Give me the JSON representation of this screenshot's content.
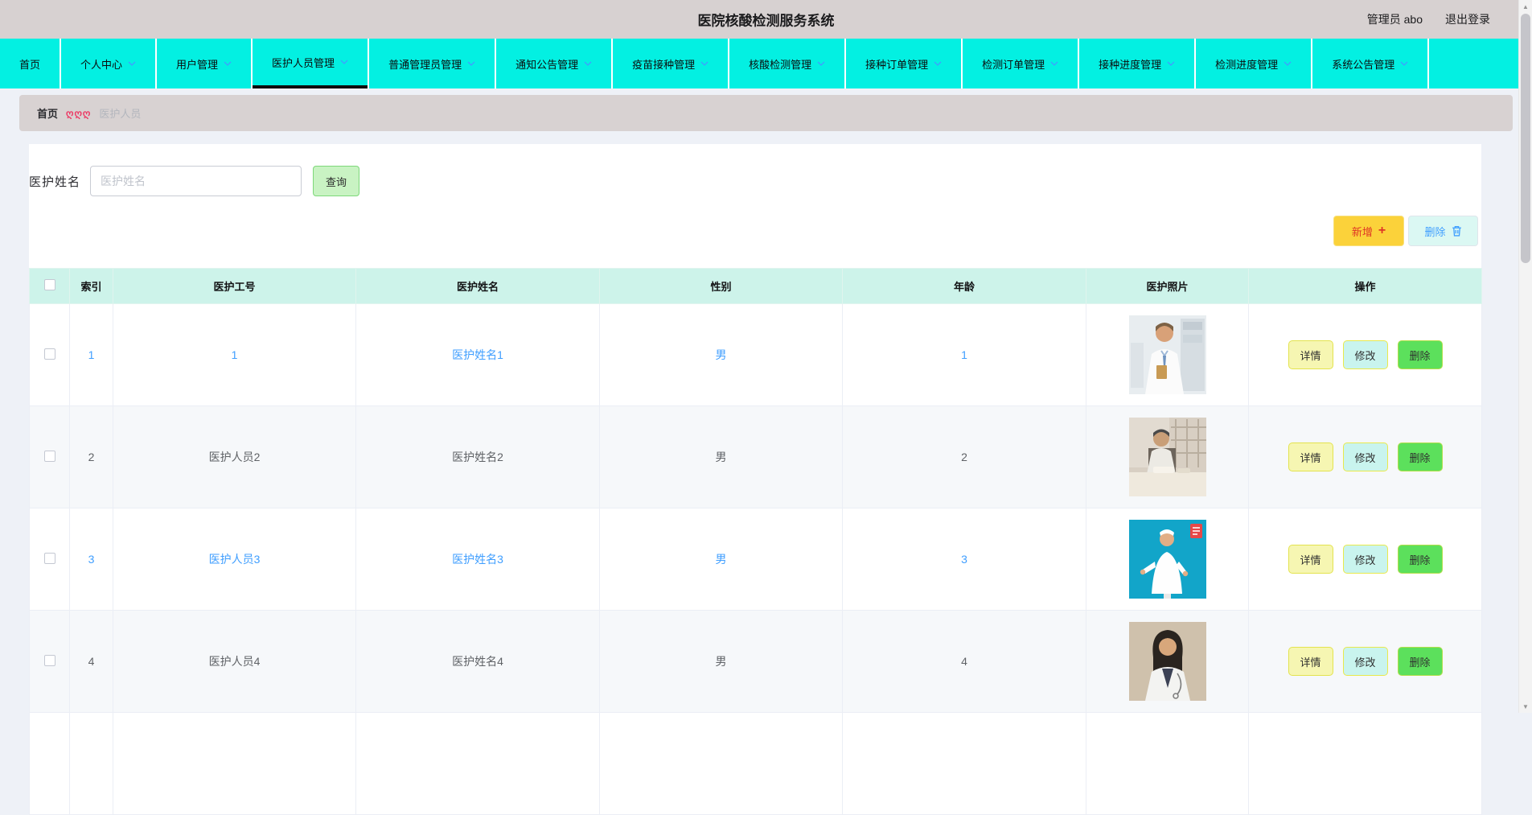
{
  "header": {
    "title": "医院核酸检测服务系统",
    "user_label": "管理员 abo",
    "logout_label": "退出登录"
  },
  "nav": {
    "active_tab": "医护人员管理",
    "tabs": [
      {
        "label": "首页",
        "has_dropdown": false
      },
      {
        "label": "个人中心",
        "has_dropdown": true
      },
      {
        "label": "用户管理",
        "has_dropdown": true
      },
      {
        "label": "医护人员管理",
        "has_dropdown": true
      },
      {
        "label": "普通管理员管理",
        "has_dropdown": true
      },
      {
        "label": "通知公告管理",
        "has_dropdown": true
      },
      {
        "label": "疫苗接种管理",
        "has_dropdown": true
      },
      {
        "label": "核酸检测管理",
        "has_dropdown": true
      },
      {
        "label": "接种订单管理",
        "has_dropdown": true
      },
      {
        "label": "检测订单管理",
        "has_dropdown": true
      },
      {
        "label": "接种进度管理",
        "has_dropdown": true
      },
      {
        "label": "检测进度管理",
        "has_dropdown": true
      },
      {
        "label": "系统公告管理",
        "has_dropdown": true
      }
    ]
  },
  "breadcrumb": {
    "home": "首页",
    "separator": "ღღღ",
    "current": "医护人员"
  },
  "search": {
    "label": "医护姓名",
    "placeholder": "医护姓名",
    "value": "",
    "query_button": "查询"
  },
  "toolbar": {
    "add_label": "新增",
    "add_icon": "+",
    "delete_label": "删除",
    "delete_icon": "trash-icon"
  },
  "table": {
    "columns": [
      "索引",
      "医护工号",
      "医护姓名",
      "性别",
      "年龄",
      "医护照片",
      "操作"
    ],
    "actions": [
      "详情",
      "修改",
      "删除"
    ],
    "rows": [
      {
        "index": "1",
        "staff_no": "1",
        "name": "医护姓名1",
        "gender": "男",
        "age": "1",
        "photo": "male-doctor-standing",
        "text_style": "link-blue"
      },
      {
        "index": "2",
        "staff_no": "医护人员2",
        "name": "医护姓名2",
        "gender": "男",
        "age": "2",
        "photo": "doctor-at-desk",
        "text_style": "normal"
      },
      {
        "index": "3",
        "staff_no": "医护人员3",
        "name": "医护姓名3",
        "gender": "男",
        "age": "3",
        "photo": "nurse-teal-background",
        "text_style": "link-blue"
      },
      {
        "index": "4",
        "staff_no": "医护人员4",
        "name": "医护姓名4",
        "gender": "男",
        "age": "4",
        "photo": "female-doctor",
        "text_style": "normal"
      }
    ]
  },
  "colors": {
    "header_bar": "#d7d1d1",
    "nav_cyan": "#03f0e2",
    "table_header_mint": "#cdf3ea",
    "link_blue": "#3f9eff",
    "breadcrumb_separator_pink": "#ec3c66",
    "add_button_yellow": "#fbd23a",
    "add_button_text_red": "#df3526",
    "delete_button_cyan": "#dbf8f3",
    "query_button_green": "#c9f3c3",
    "action_detail_yellow": "#f6f6b2",
    "action_edit_cyan": "#c9f4ee",
    "action_delete_green": "#5ce05c"
  }
}
